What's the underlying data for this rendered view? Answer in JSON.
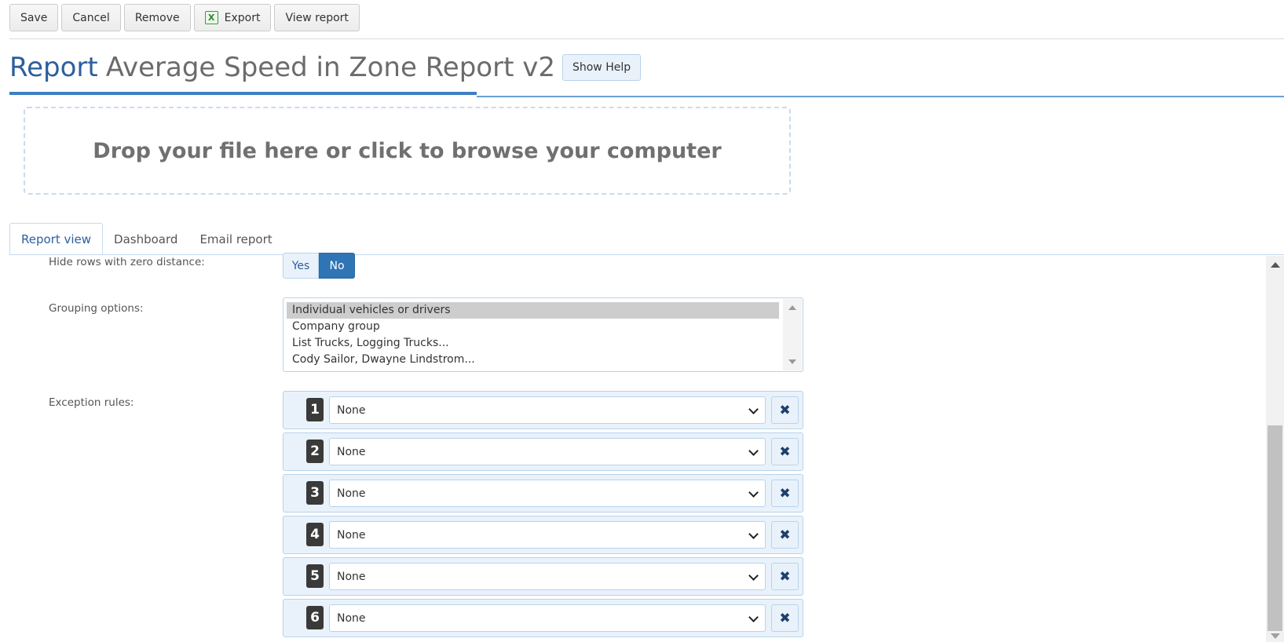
{
  "toolbar": {
    "save": "Save",
    "cancel": "Cancel",
    "remove": "Remove",
    "export": "Export",
    "view_report": "View report",
    "export_icon": "excel-icon"
  },
  "header": {
    "title_prefix": "Report",
    "title_name": "Average Speed in Zone Report v2",
    "show_help": "Show Help",
    "accent_color": "#2c5f9e"
  },
  "dropzone": {
    "text": "Drop your file here or click to browse your computer"
  },
  "tabs": [
    {
      "label": "Report view",
      "active": true
    },
    {
      "label": "Dashboard",
      "active": false
    },
    {
      "label": "Email report",
      "active": false
    }
  ],
  "form": {
    "hide_zero": {
      "label": "Hide rows with zero distance:",
      "yes": "Yes",
      "no": "No",
      "selected": "No"
    },
    "grouping": {
      "label": "Grouping options:",
      "options": [
        "Individual vehicles or drivers",
        "Company group",
        "List Trucks, Logging Trucks...",
        "Cody Sailor, Dwayne Lindstrom..."
      ],
      "selected": "Individual vehicles or drivers"
    },
    "exceptions": {
      "label": "Exception rules:",
      "rules": [
        {
          "num": "1",
          "value": "None"
        },
        {
          "num": "2",
          "value": "None"
        },
        {
          "num": "3",
          "value": "None"
        },
        {
          "num": "4",
          "value": "None"
        },
        {
          "num": "5",
          "value": "None"
        },
        {
          "num": "6",
          "value": "None"
        }
      ],
      "delete_glyph": "✖"
    }
  }
}
